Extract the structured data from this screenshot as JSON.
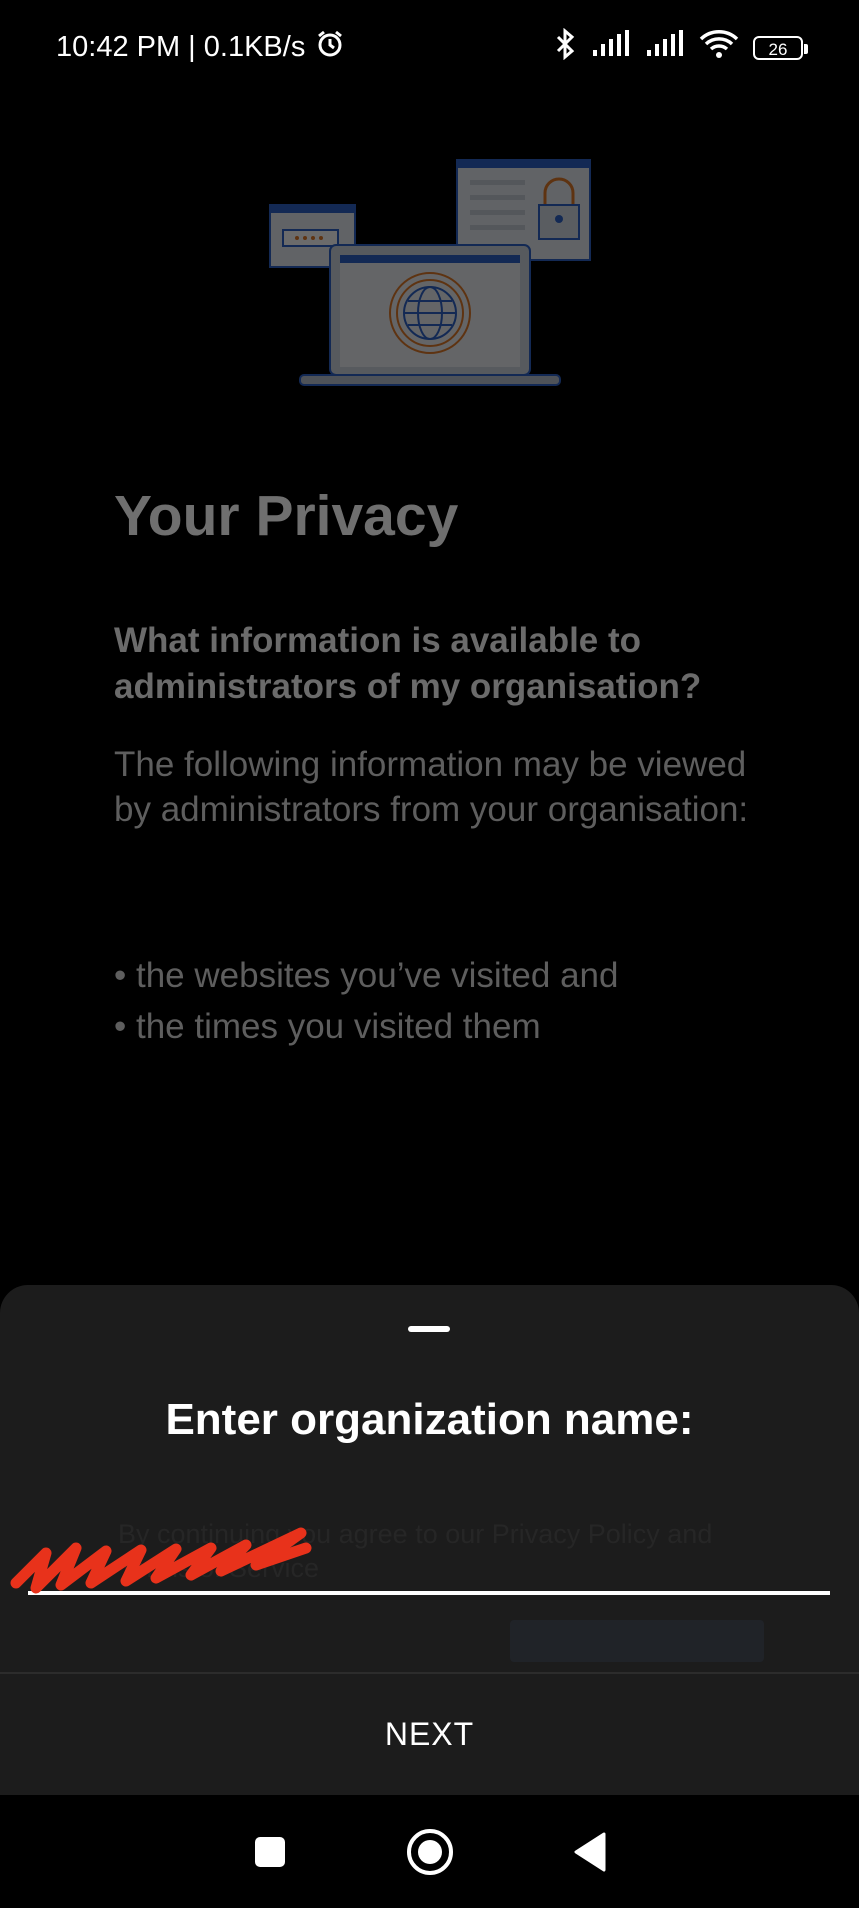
{
  "status_bar": {
    "time_speed": "10:42 PM | 0.1KB/s",
    "battery": "26",
    "icons": [
      "alarm-icon",
      "bluetooth-icon",
      "signal-icon",
      "signal-icon",
      "wifi-icon",
      "battery-icon"
    ]
  },
  "privacy": {
    "title": "Your Privacy",
    "question": "What information is available to administrators of my organisation?",
    "description": "The following information may be viewed by administrators from your organisation:",
    "bullets": [
      "the websites you’ve visited and",
      "the times you visited them"
    ]
  },
  "sheet": {
    "title": "Enter organization name:",
    "input_value": "",
    "behind_text": "By continuing you agree to our Privacy Policy and Terms of Service",
    "next_label": "NEXT"
  },
  "nav": {
    "icons": [
      "recents-icon",
      "home-icon",
      "back-icon"
    ]
  },
  "colors": {
    "background": "#000000",
    "sheet": "#1c1c1c",
    "redaction": "#e8321b",
    "illustration_blue": "#2e63c8",
    "illustration_orange": "#e07a2a"
  }
}
